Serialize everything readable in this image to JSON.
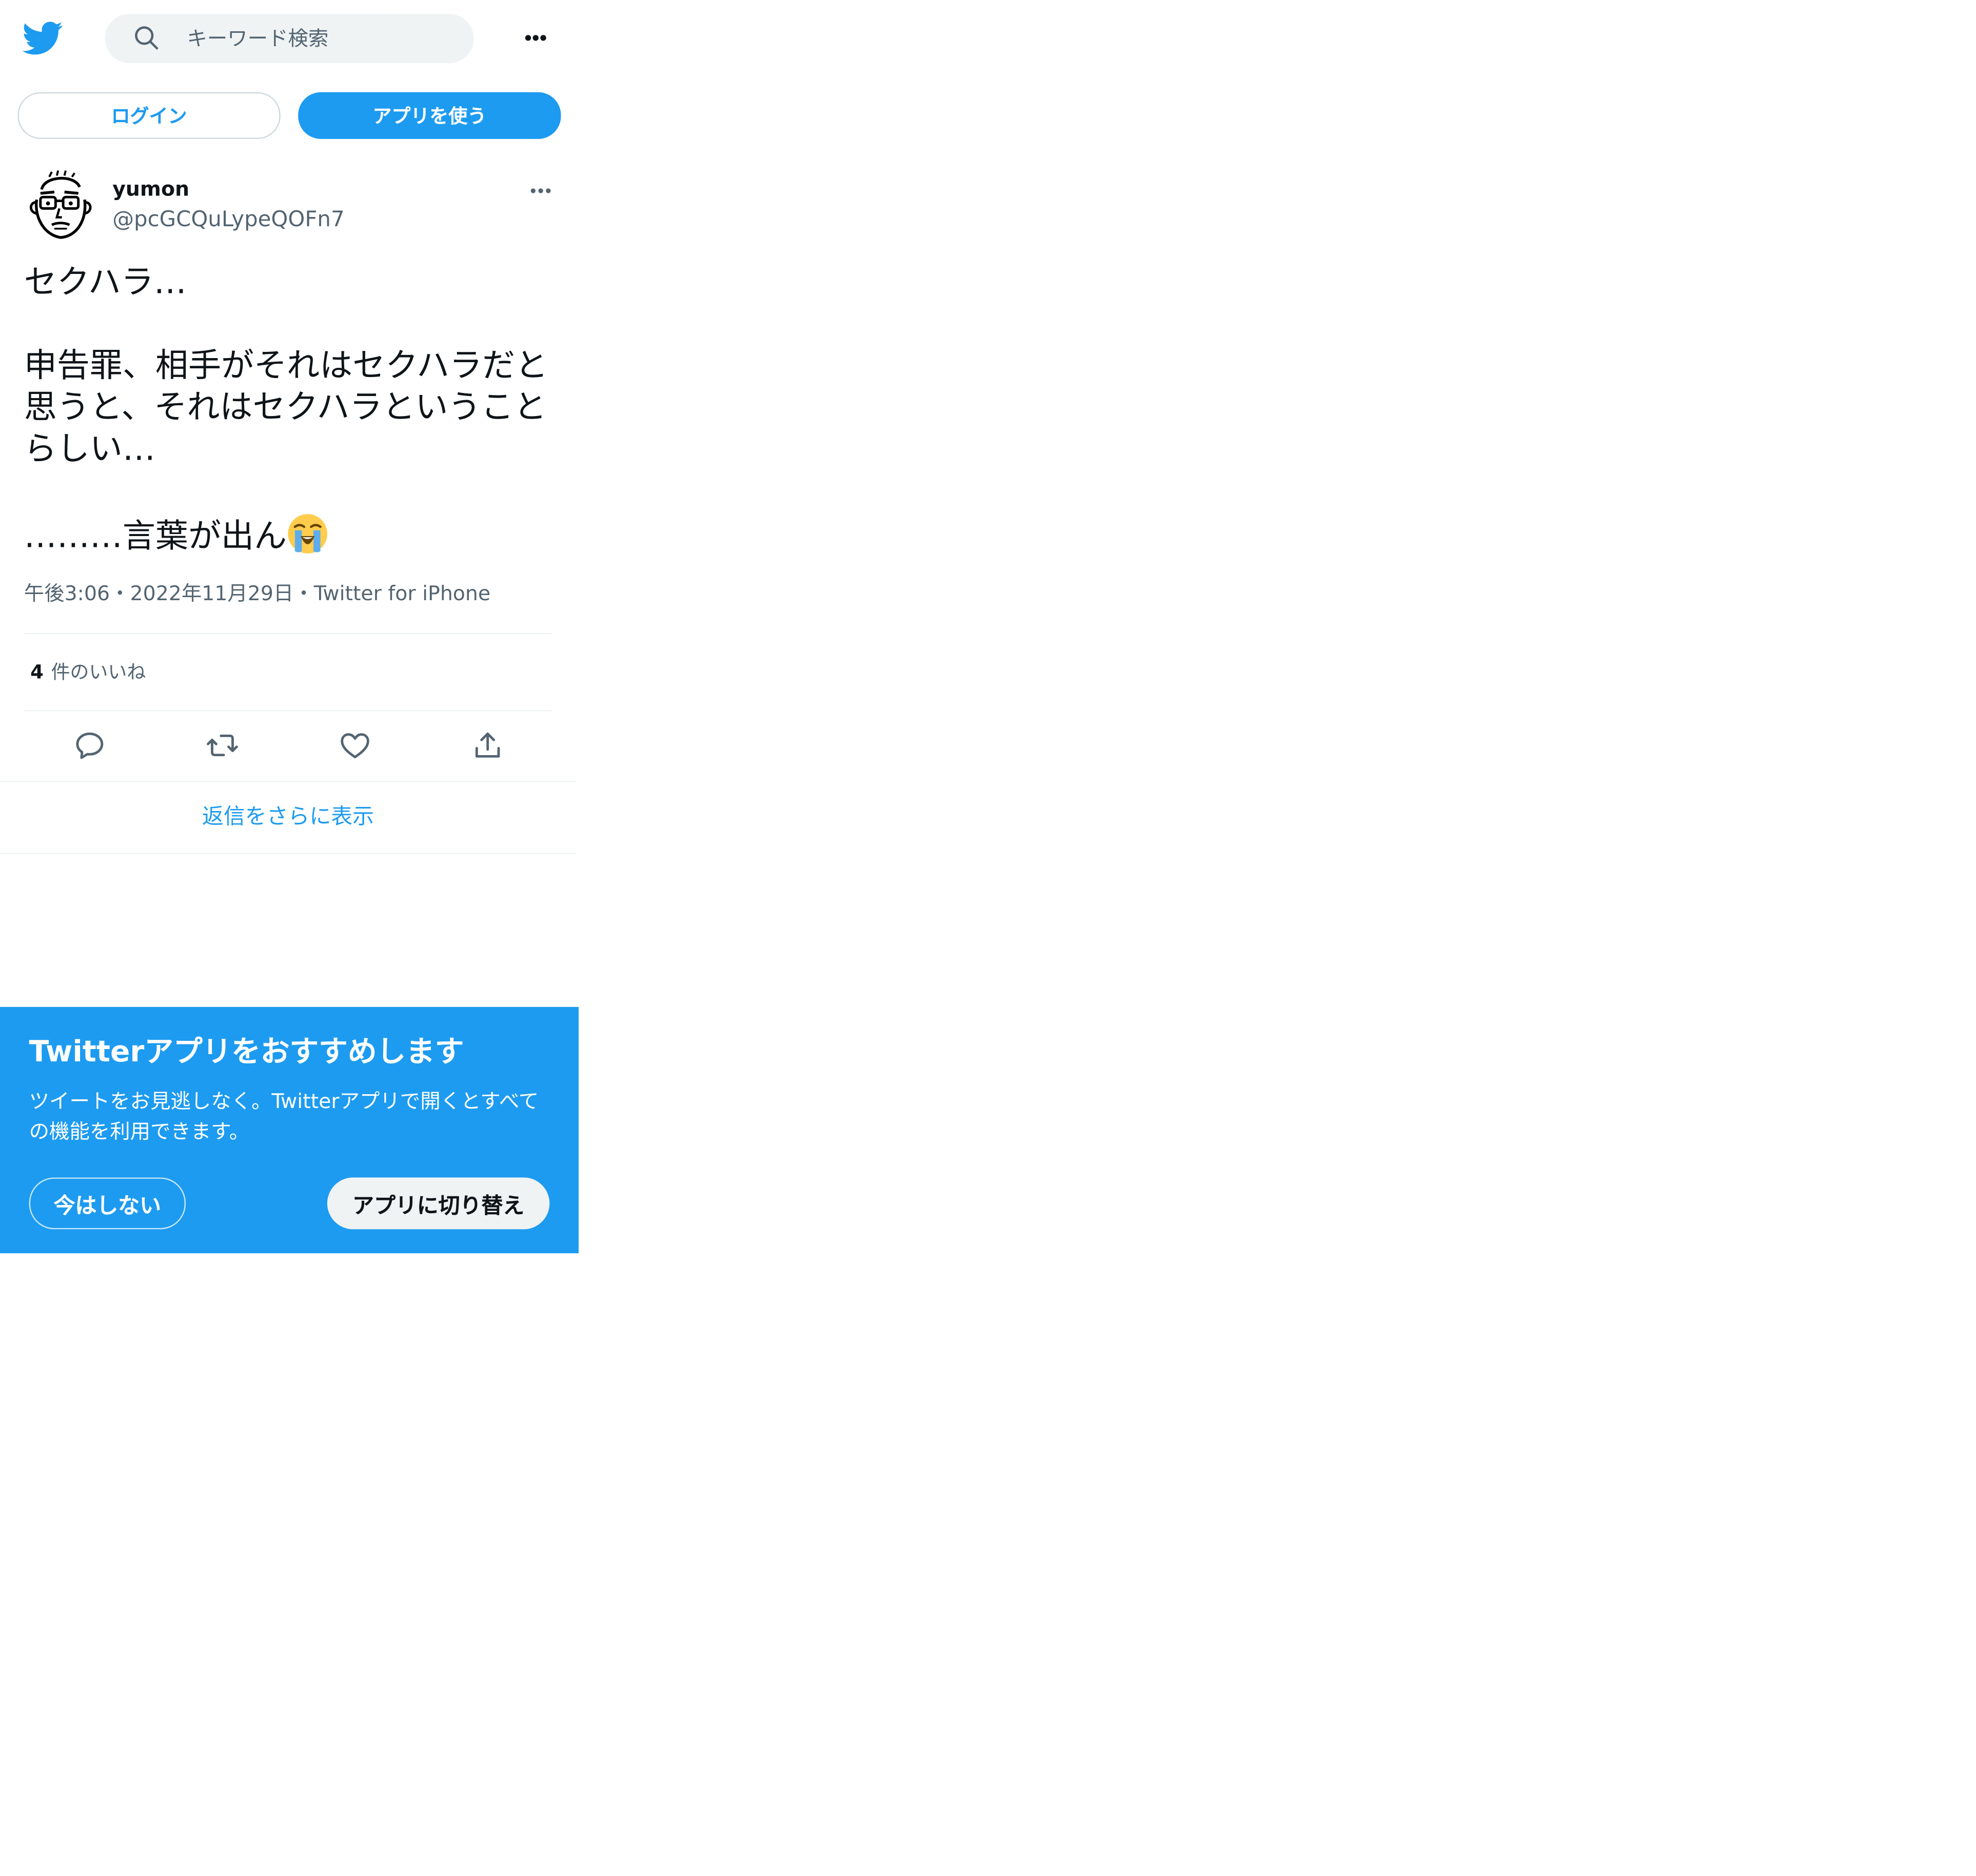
{
  "header": {
    "search_placeholder": "キーワード検索",
    "logo_icon": "twitter-bird-icon",
    "more_icon": "more-horizontal-icon"
  },
  "auth": {
    "login_label": "ログイン",
    "use_app_label": "アプリを使う"
  },
  "tweet": {
    "author_name": "yumon",
    "author_handle": "@pcGCQuLypeQOFn7",
    "paragraph_1": "セクハラ…",
    "paragraph_2": "申告罪、相手がそれはセクハラだと思うと、それはセクハラということらしい…",
    "paragraph_3": "………言葉が出ん",
    "emoji": "loudly-crying-face-emoji",
    "time": "午後3:06",
    "date": "2022年11月29日",
    "source": "Twitter for iPhone",
    "meta_separator": "・",
    "likes_count": "4",
    "likes_label": "件のいいね",
    "actions": [
      "reply-icon",
      "retweet-icon",
      "like-icon",
      "share-icon"
    ]
  },
  "more_replies_label": "返信をさらに表示",
  "promo": {
    "title": "Twitterアプリをおすすめします",
    "body": "ツイートをお見逃しなく。Twitterアプリで開くとすべての機能を利用できます。",
    "not_now_label": "今はしない",
    "switch_label": "アプリに切り替え"
  },
  "colors": {
    "brand": "#1d9bf0",
    "text": "#0f1419",
    "secondary_text": "#536471",
    "search_bg": "#eff3f4",
    "divider": "#eff3f4"
  }
}
